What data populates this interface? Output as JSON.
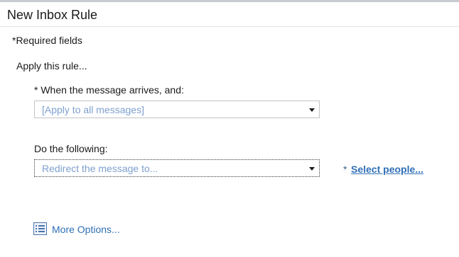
{
  "dialog": {
    "title": "New Inbox Rule",
    "required_note": "*Required fields",
    "apply_label": "Apply this rule..."
  },
  "condition": {
    "label": "* When the message arrives, and:",
    "selected_value": "[Apply to all messages]"
  },
  "action": {
    "label": "Do the following:",
    "selected_value": "Redirect the message to...",
    "required_marker": "*",
    "select_people_link": "Select people..."
  },
  "more_options": {
    "label": "More Options...",
    "icon": "list-options-icon"
  },
  "colors": {
    "link": "#2f6fb6",
    "dropdown_text": "#7e9fd0",
    "title_text": "#1a1a1a"
  }
}
